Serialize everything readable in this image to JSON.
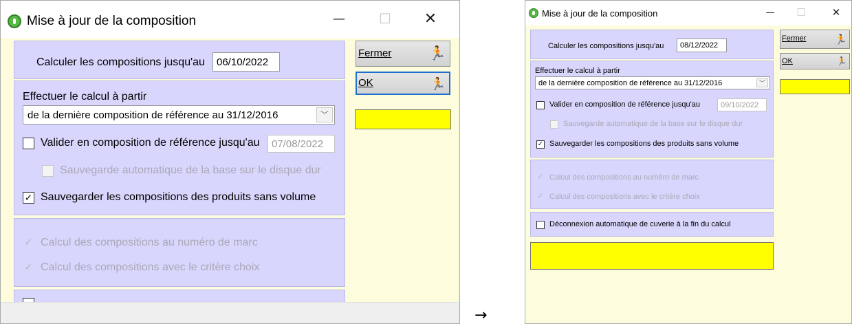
{
  "arrow": "→",
  "left": {
    "title": "Mise à jour de la composition",
    "controls": {
      "minimize": "—",
      "maximize": "☐",
      "close": "✕"
    },
    "calc_label": "Calculer les compositions jusqu'au",
    "calc_date": "06/10/2022",
    "effect_label": "Effectuer le calcul à partir",
    "combo_value": "de la dernière composition de référence au 31/12/2016",
    "valider_label": "Valider en composition de référence jusqu'au",
    "valider_date": "07/08/2022",
    "sauvegarde_auto_label": "Sauvegarde automatique de la base sur le disque dur",
    "sauvegarder_label": "Sauvegarder les compositions des produits sans volume",
    "marc_label": "Calcul des compositions au numéro de marc",
    "choix_label": "Calcul des compositions avec le critère choix",
    "fermer_label": "Fermer",
    "ok_label": "OK"
  },
  "right": {
    "title": "Mise à jour de la composition",
    "controls": {
      "minimize": "—",
      "maximize": "☐",
      "close": "✕"
    },
    "calc_label": "Calculer les compositions jusqu'au",
    "calc_date": "08/12/2022",
    "effect_label": "Effectuer le calcul à partir",
    "combo_value": "de la dernière composition de référence au 31/12/2016",
    "valider_label": "Valider en composition de référence jusqu'au",
    "valider_date": "09/10/2022",
    "sauvegarde_auto_label": "Sauvegarde automatique de la base sur le disque dur",
    "sauvegarder_label": "Sauvegarder les compositions des produits sans volume",
    "marc_label": "Calcul des compositions au numéro de marc",
    "choix_label": "Calcul des compositions avec le critère choix",
    "deconnexion_label": "Déconnexion automatique de cuverie à la fin du calcul",
    "fermer_label": "Fermer",
    "ok_label": "OK"
  },
  "states": {
    "valider_checked": false,
    "sauvegarde_auto_checked": false,
    "sauvegarder_checked": true,
    "marc_checked": true,
    "choix_checked": true,
    "deconnexion_checked": false
  },
  "colors": {
    "panel": "#d8d6fc",
    "client": "#fdfcdc",
    "indicator": "#ffff00",
    "focus": "#1f6fd1"
  }
}
